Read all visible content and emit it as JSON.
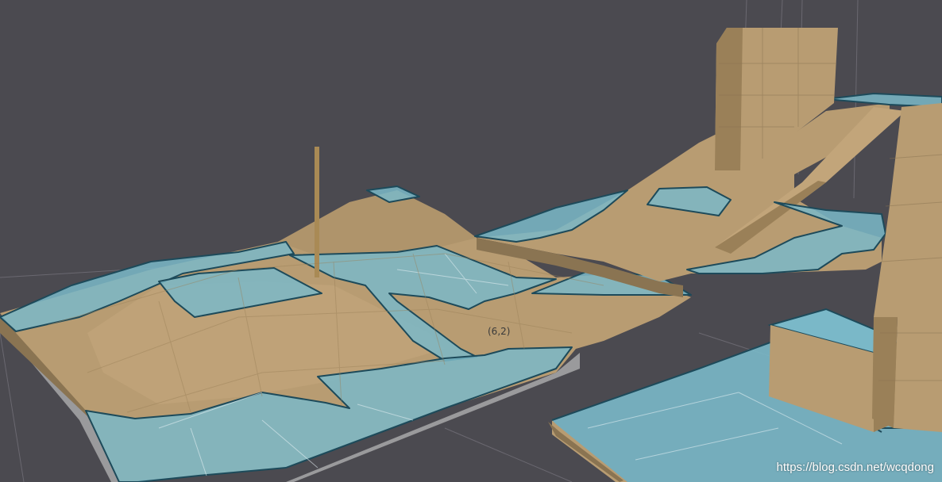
{
  "viewport": {
    "coordinate_label": "(6,2)",
    "watermark": "https://blog.csdn.net/wcqdong"
  },
  "colors": {
    "background": "#4b4a50",
    "terrain": "#b89c72",
    "terrain_dark": "#8a7452",
    "navmesh": "#7ab8c8",
    "navmesh_edge": "#1d4a5a",
    "grid_line": "#6a6870"
  }
}
